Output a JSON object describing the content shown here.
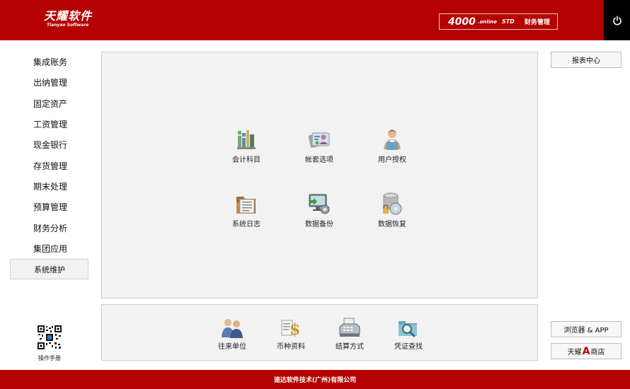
{
  "header": {
    "logo_text": "天耀软件",
    "logo_subtext": "Tianyao Software",
    "product_number": "4000",
    "product_online": ".online",
    "product_std": "STD",
    "product_edition": "财务管理",
    "power_icon": "power-icon"
  },
  "sidebar": {
    "items": [
      {
        "label": "集成账务",
        "active": false
      },
      {
        "label": "出纳管理",
        "active": false
      },
      {
        "label": "固定资产",
        "active": false
      },
      {
        "label": "工资管理",
        "active": false
      },
      {
        "label": "现金银行",
        "active": false
      },
      {
        "label": "存货管理",
        "active": false
      },
      {
        "label": "期末处理",
        "active": false
      },
      {
        "label": "预算管理",
        "active": false
      },
      {
        "label": "财务分析",
        "active": false
      },
      {
        "label": "集团应用",
        "active": false
      },
      {
        "label": "系统维护",
        "active": true
      }
    ]
  },
  "main": {
    "tiles": [
      {
        "label": "会计科目",
        "icon": "books-icon"
      },
      {
        "label": "帐套选项",
        "icon": "id-card-icon"
      },
      {
        "label": "用户授权",
        "icon": "user-icon"
      },
      {
        "label": "系统日志",
        "icon": "folder-icon"
      },
      {
        "label": "数据备份",
        "icon": "monitor-gear-icon"
      },
      {
        "label": "数据恢复",
        "icon": "database-disc-icon"
      }
    ]
  },
  "bottom": {
    "tiles": [
      {
        "label": "往来单位",
        "icon": "people-icon"
      },
      {
        "label": "币种资料",
        "icon": "currency-icon"
      },
      {
        "label": "结算方式",
        "icon": "cash-register-icon"
      },
      {
        "label": "凭证查找",
        "icon": "search-folder-icon"
      }
    ]
  },
  "right": {
    "report_center": "报表中心",
    "browser_app": "浏览器 & APP",
    "store_prefix": "天耀",
    "store_a": "A",
    "store_suffix": "商店"
  },
  "qr": {
    "label": "操作手册",
    "icon": "qr-code-icon"
  },
  "footer": {
    "text": "速达软件技术(广州)有限公司"
  },
  "colors": {
    "brand_red": "#b40000",
    "panel_bg": "#f2f2f2",
    "border": "#cfcfcf"
  }
}
